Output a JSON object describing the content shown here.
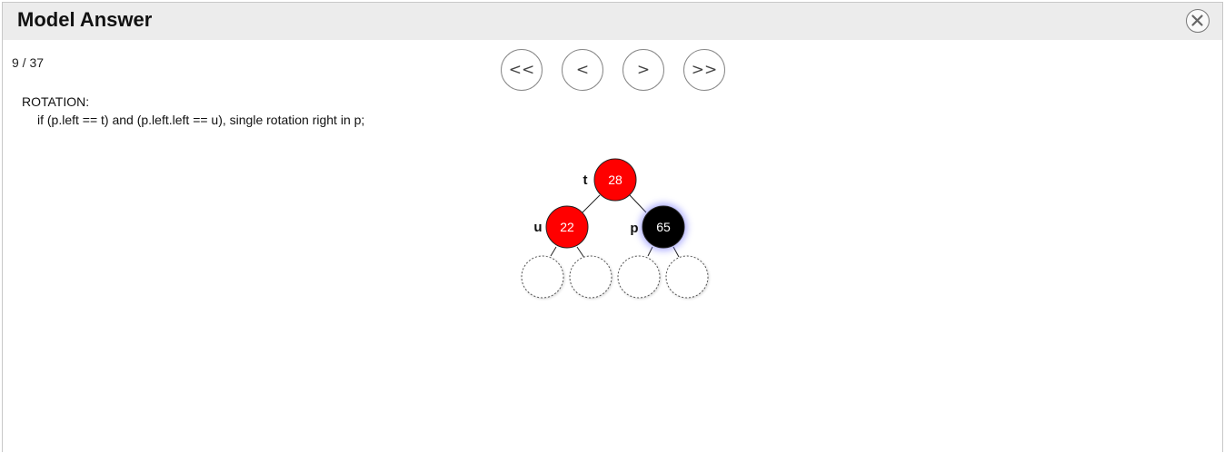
{
  "dialog": {
    "title": "Model Answer",
    "close_icon": "close-icon"
  },
  "step": {
    "counter": "9 / 37"
  },
  "nav": {
    "first_label": "<<",
    "prev_label": "<",
    "next_label": ">",
    "last_label": ">>"
  },
  "code": {
    "line1": "ROTATION:",
    "line2": "if (p.left == t) and (p.left.left == u), single rotation right in p;"
  },
  "tree": {
    "colors": {
      "red": "#ff0000",
      "black": "#000000",
      "highlight": "#6a6aff",
      "empty_stroke": "#555555"
    },
    "nodes": [
      {
        "id": "n28",
        "value": "28",
        "color": "red",
        "var": "t",
        "highlight": false
      },
      {
        "id": "n22",
        "value": "22",
        "color": "red",
        "var": "u",
        "highlight": false
      },
      {
        "id": "n65",
        "value": "65",
        "color": "black",
        "var": "p",
        "highlight": true
      }
    ]
  }
}
